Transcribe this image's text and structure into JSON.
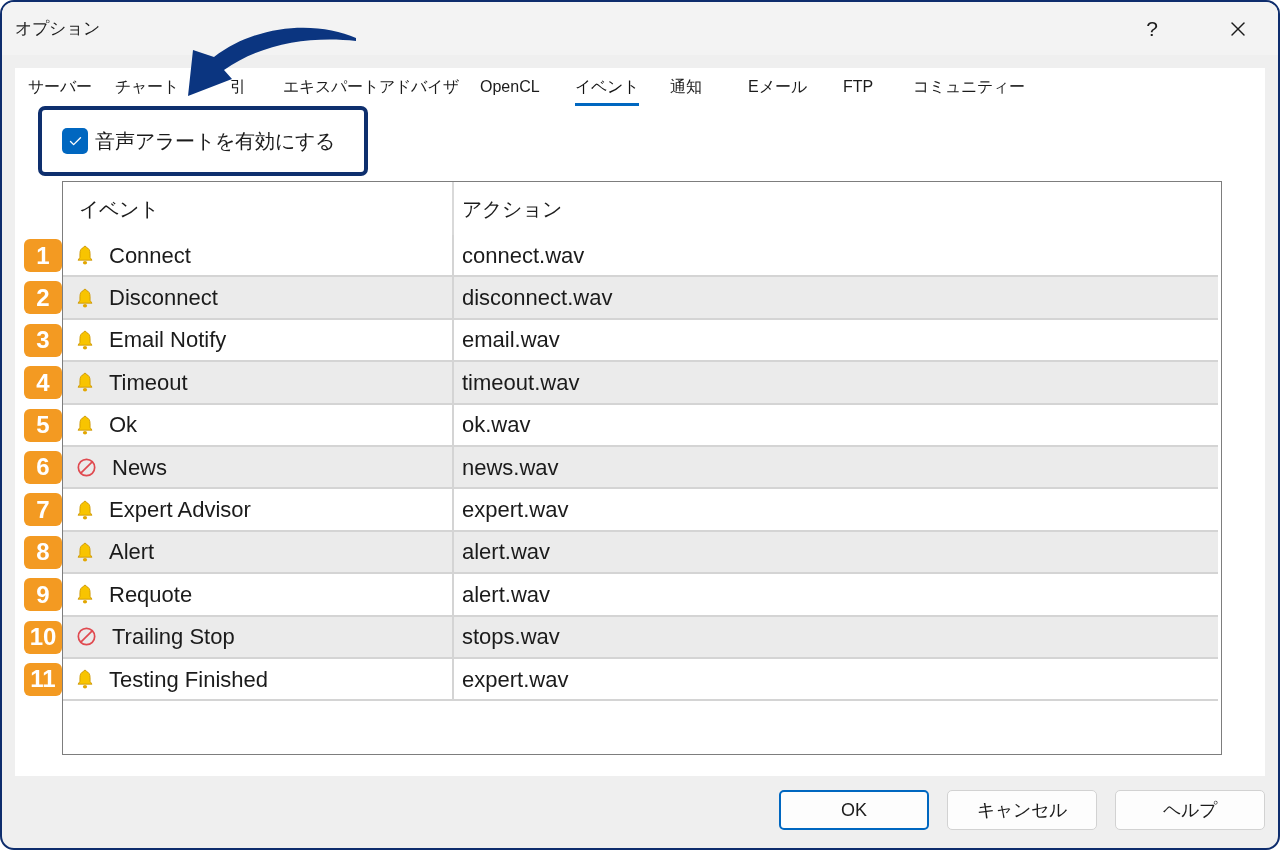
{
  "window": {
    "title": "オプション",
    "help": "?"
  },
  "tabs": [
    {
      "label": "サーバー",
      "selected": false
    },
    {
      "label": "チャート",
      "selected": false
    },
    {
      "label": "引",
      "selected": false
    },
    {
      "label": "エキスパートアドバイザ",
      "selected": false
    },
    {
      "label": "OpenCL",
      "selected": false
    },
    {
      "label": "イベント",
      "selected": true
    },
    {
      "label": "通知",
      "selected": false
    },
    {
      "label": "Eメール",
      "selected": false
    },
    {
      "label": "FTP",
      "selected": false
    },
    {
      "label": "コミュニティー",
      "selected": false
    }
  ],
  "sound_alerts": {
    "label": "音声アラートを有効にする",
    "checked": true
  },
  "table": {
    "columns": [
      "イベント",
      "アクション"
    ],
    "rows": [
      {
        "badge": "1",
        "event": "Connect",
        "enabled": true,
        "action": "connect.wav"
      },
      {
        "badge": "2",
        "event": "Disconnect",
        "enabled": true,
        "action": "disconnect.wav"
      },
      {
        "badge": "3",
        "event": "Email Notify",
        "enabled": true,
        "action": "email.wav"
      },
      {
        "badge": "4",
        "event": "Timeout",
        "enabled": true,
        "action": "timeout.wav"
      },
      {
        "badge": "5",
        "event": "Ok",
        "enabled": true,
        "action": "ok.wav"
      },
      {
        "badge": "6",
        "event": "News",
        "enabled": false,
        "action": "news.wav"
      },
      {
        "badge": "7",
        "event": "Expert Advisor",
        "enabled": true,
        "action": "expert.wav"
      },
      {
        "badge": "8",
        "event": "Alert",
        "enabled": true,
        "action": "alert.wav"
      },
      {
        "badge": "9",
        "event": "Requote",
        "enabled": true,
        "action": "alert.wav"
      },
      {
        "badge": "10",
        "event": "Trailing Stop",
        "enabled": false,
        "action": "stops.wav"
      },
      {
        "badge": "11",
        "event": "Testing Finished",
        "enabled": true,
        "action": "expert.wav"
      }
    ]
  },
  "buttons": [
    {
      "label": "OK",
      "default": true
    },
    {
      "label": "キャンセル",
      "default": false
    },
    {
      "label": "ヘルプ",
      "default": false
    }
  ]
}
